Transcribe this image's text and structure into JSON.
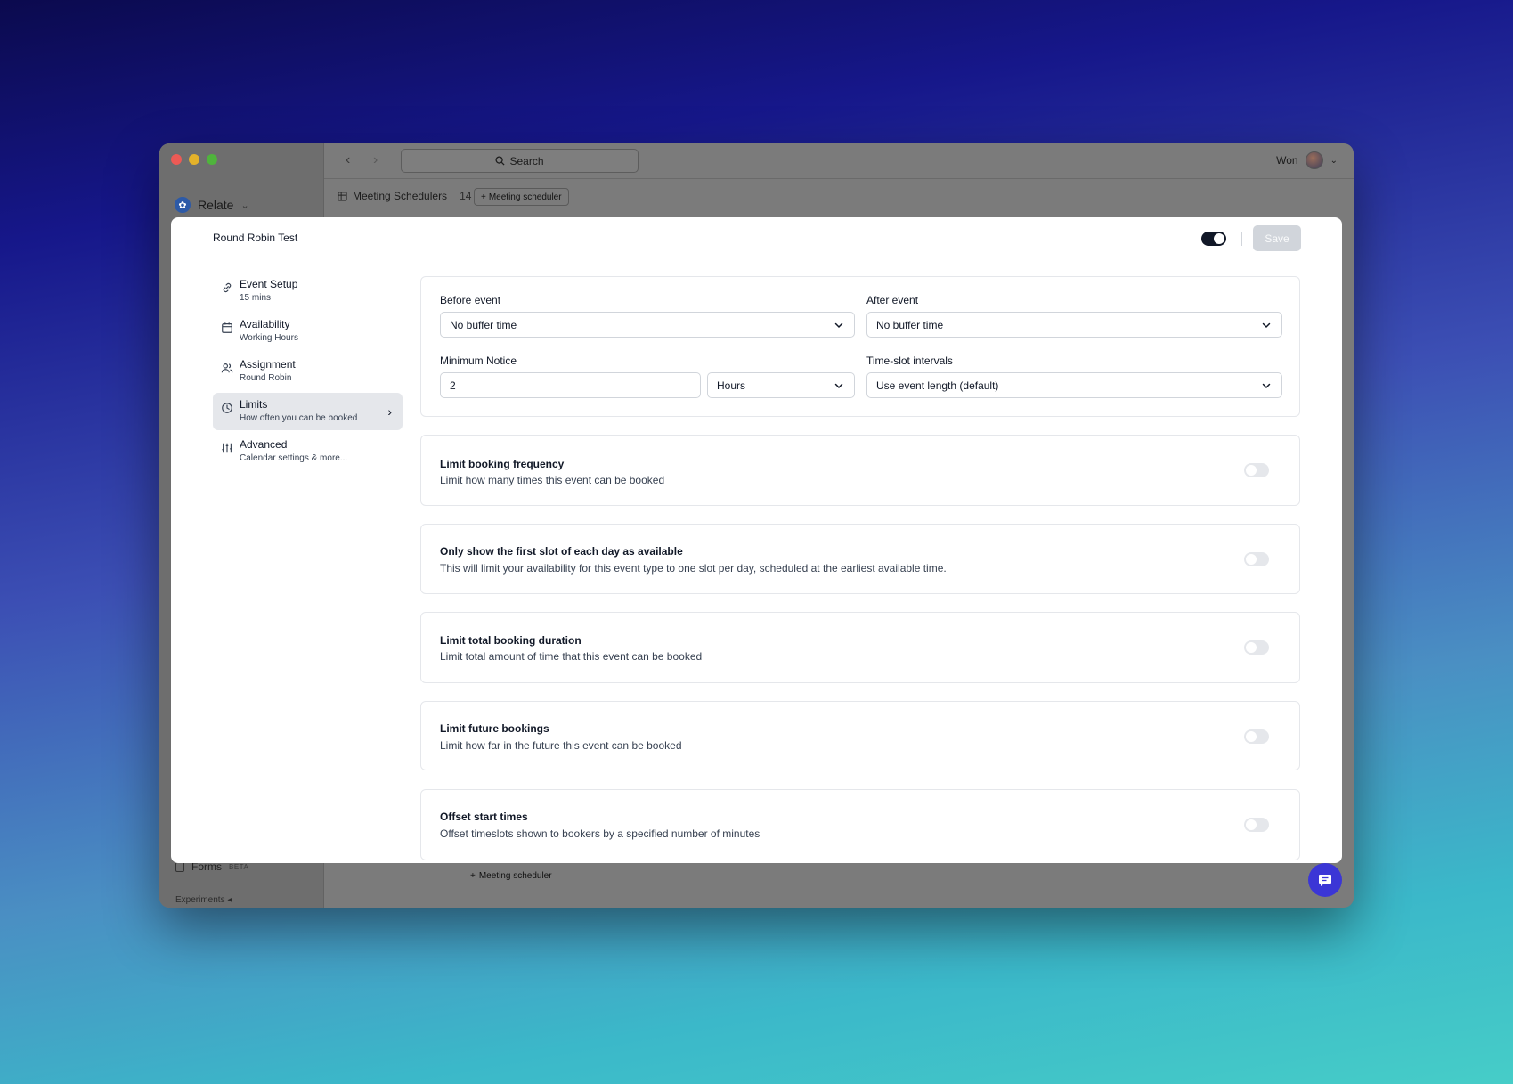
{
  "app": {
    "workspace": "Relate",
    "search_placeholder": "Search",
    "user_name": "Won",
    "page_title": "Meeting Schedulers",
    "page_count": "14",
    "add_button": "Meeting scheduler",
    "bottom_add": "Meeting scheduler",
    "forms_label": "Forms",
    "forms_badge": "BETA",
    "experiments_label": "Experiments"
  },
  "modal": {
    "title": "Round Robin Test",
    "save_label": "Save",
    "nav": [
      {
        "label": "Event Setup",
        "sub": "15 mins",
        "icon": "link-icon"
      },
      {
        "label": "Availability",
        "sub": "Working Hours",
        "icon": "calendar-icon"
      },
      {
        "label": "Assignment",
        "sub": "Round Robin",
        "icon": "users-icon"
      },
      {
        "label": "Limits",
        "sub": "How often you can be booked",
        "icon": "clock-icon"
      },
      {
        "label": "Advanced",
        "sub": "Calendar settings & more...",
        "icon": "sliders-icon"
      }
    ],
    "buffer": {
      "before_label": "Before event",
      "before_value": "No buffer time",
      "after_label": "After event",
      "after_value": "No buffer time",
      "notice_label": "Minimum Notice",
      "notice_value": "2",
      "notice_unit": "Hours",
      "interval_label": "Time-slot intervals",
      "interval_value": "Use event length (default)"
    },
    "switches": [
      {
        "title": "Limit booking frequency",
        "desc": "Limit how many times this event can be booked",
        "on": false
      },
      {
        "title": "Only show the first slot of each day as available",
        "desc": "This will limit your availability for this event type to one slot per day, scheduled at the earliest available time.",
        "on": false
      },
      {
        "title": "Limit total booking duration",
        "desc": "Limit total amount of time that this event can be booked",
        "on": false
      },
      {
        "title": "Limit future bookings",
        "desc": "Limit how far in the future this event can be booked",
        "on": false
      },
      {
        "title": "Offset start times",
        "desc": "Offset timeslots shown to bookers by a specified number of minutes",
        "on": false
      }
    ]
  }
}
